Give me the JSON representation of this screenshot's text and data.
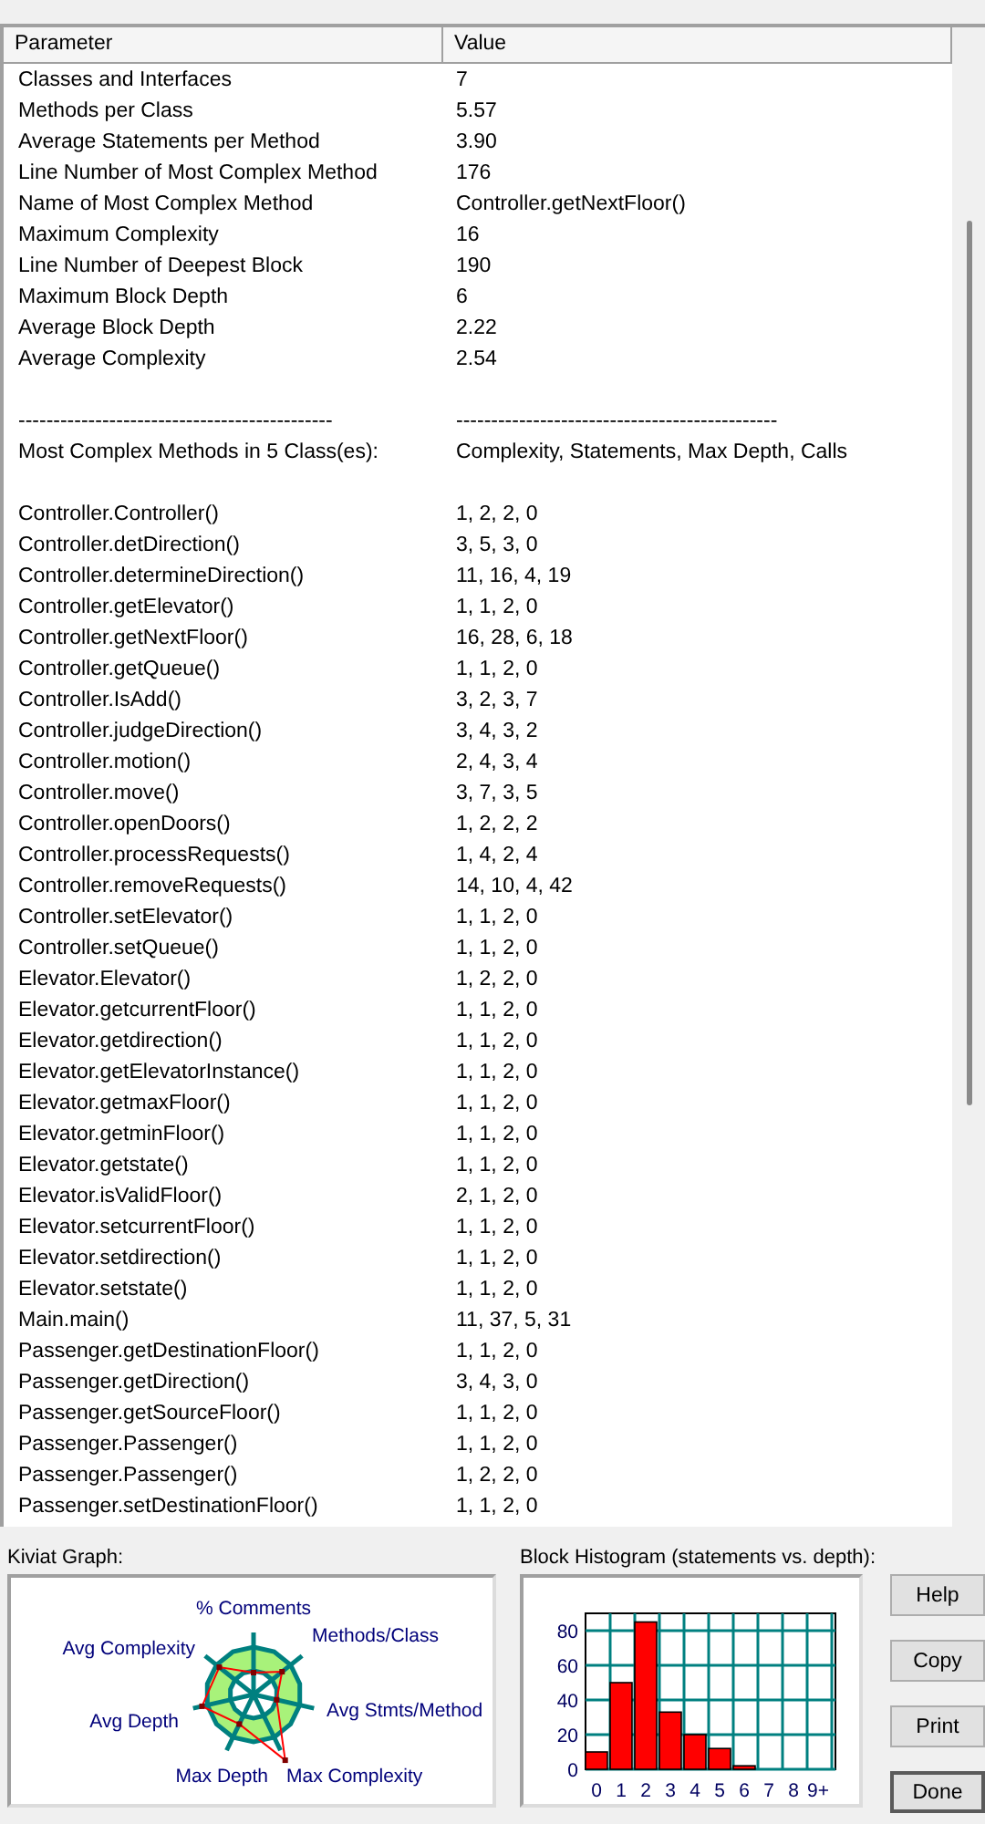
{
  "table": {
    "columns": [
      "Parameter",
      "Value"
    ],
    "rows": [
      {
        "parameter": "Classes and Interfaces",
        "value": "7"
      },
      {
        "parameter": "Methods per Class",
        "value": "5.57"
      },
      {
        "parameter": "Average Statements per Method",
        "value": "3.90"
      },
      {
        "parameter": "Line Number of Most Complex Method",
        "value": "176"
      },
      {
        "parameter": "Name of Most Complex Method",
        "value": "Controller.getNextFloor()"
      },
      {
        "parameter": "Maximum Complexity",
        "value": "16"
      },
      {
        "parameter": "Line Number of Deepest Block",
        "value": "190"
      },
      {
        "parameter": "Maximum Block Depth",
        "value": "6"
      },
      {
        "parameter": "Average Block Depth",
        "value": "2.22"
      },
      {
        "parameter": "Average Complexity",
        "value": "2.54"
      }
    ],
    "separator": {
      "parameter": "---------------------------------------------",
      "value": "----------------------------------------------"
    },
    "methods_header": {
      "parameter": "Most Complex Methods in 5 Class(es):",
      "value": "Complexity, Statements, Max Depth, Calls"
    },
    "methods": [
      {
        "parameter": "Controller.Controller()",
        "value": "1, 2, 2, 0"
      },
      {
        "parameter": "Controller.detDirection()",
        "value": "3, 5, 3, 0"
      },
      {
        "parameter": "Controller.determineDirection()",
        "value": "11, 16, 4, 19"
      },
      {
        "parameter": "Controller.getElevator()",
        "value": "1, 1, 2, 0"
      },
      {
        "parameter": "Controller.getNextFloor()",
        "value": "16, 28, 6, 18"
      },
      {
        "parameter": "Controller.getQueue()",
        "value": "1, 1, 2, 0"
      },
      {
        "parameter": "Controller.IsAdd()",
        "value": "3, 2, 3, 7"
      },
      {
        "parameter": "Controller.judgeDirection()",
        "value": "3, 4, 3, 2"
      },
      {
        "parameter": "Controller.motion()",
        "value": "2, 4, 3, 4"
      },
      {
        "parameter": "Controller.move()",
        "value": "3, 7, 3, 5"
      },
      {
        "parameter": "Controller.openDoors()",
        "value": "1, 2, 2, 2"
      },
      {
        "parameter": "Controller.processRequests()",
        "value": "1, 4, 2, 4"
      },
      {
        "parameter": "Controller.removeRequests()",
        "value": "14, 10, 4, 42"
      },
      {
        "parameter": "Controller.setElevator()",
        "value": "1, 1, 2, 0"
      },
      {
        "parameter": "Controller.setQueue()",
        "value": "1, 1, 2, 0"
      },
      {
        "parameter": "Elevator.Elevator()",
        "value": "1, 2, 2, 0"
      },
      {
        "parameter": "Elevator.getcurrentFloor()",
        "value": "1, 1, 2, 0"
      },
      {
        "parameter": "Elevator.getdirection()",
        "value": "1, 1, 2, 0"
      },
      {
        "parameter": "Elevator.getElevatorInstance()",
        "value": "1, 1, 2, 0"
      },
      {
        "parameter": "Elevator.getmaxFloor()",
        "value": "1, 1, 2, 0"
      },
      {
        "parameter": "Elevator.getminFloor()",
        "value": "1, 1, 2, 0"
      },
      {
        "parameter": "Elevator.getstate()",
        "value": "1, 1, 2, 0"
      },
      {
        "parameter": "Elevator.isValidFloor()",
        "value": "2, 1, 2, 0"
      },
      {
        "parameter": "Elevator.setcurrentFloor()",
        "value": "1, 1, 2, 0"
      },
      {
        "parameter": "Elevator.setdirection()",
        "value": "1, 1, 2, 0"
      },
      {
        "parameter": "Elevator.setstate()",
        "value": "1, 1, 2, 0"
      },
      {
        "parameter": "Main.main()",
        "value": "11, 37, 5, 31"
      },
      {
        "parameter": "Passenger.getDestinationFloor()",
        "value": "1, 1, 2, 0"
      },
      {
        "parameter": "Passenger.getDirection()",
        "value": "3, 4, 3, 0"
      },
      {
        "parameter": "Passenger.getSourceFloor()",
        "value": "1, 1, 2, 0"
      },
      {
        "parameter": "Passenger.Passenger()",
        "value": "1, 1, 2, 0"
      },
      {
        "parameter": "Passenger.Passenger()",
        "value": "1, 2, 2, 0"
      },
      {
        "parameter": "Passenger.setDestinationFloor()",
        "value": "1, 1, 2, 0"
      }
    ]
  },
  "kiviat": {
    "label": "Kiviat Graph:",
    "axes": [
      "% Comments",
      "Methods/Class",
      "Avg Complexity",
      "Avg Stmts/Method",
      "Avg Depth",
      "Max Depth",
      "Max Complexity"
    ]
  },
  "histogram": {
    "label": "Block Histogram (statements vs. depth):",
    "chart_data": {
      "type": "bar",
      "grid": true,
      "categories": [
        "0",
        "1",
        "2",
        "3",
        "4",
        "5",
        "6",
        "7",
        "8",
        "9+"
      ],
      "values": [
        10,
        50,
        85,
        33,
        20,
        12,
        2,
        0,
        0,
        0
      ],
      "ylim": [
        0,
        90
      ],
      "yticks": [
        0,
        20,
        40,
        60,
        80
      ]
    }
  },
  "buttons": [
    {
      "label": "Help",
      "default": false
    },
    {
      "label": "Copy",
      "default": false
    },
    {
      "label": "Print",
      "default": false
    },
    {
      "label": "Done",
      "default": true
    }
  ]
}
